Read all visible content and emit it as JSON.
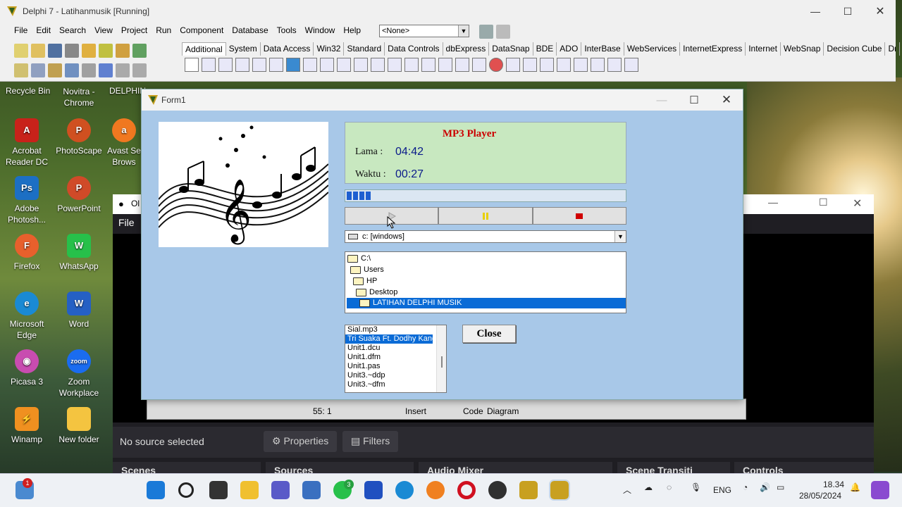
{
  "desktop": {
    "top_labels": [
      "Recycle Bin",
      "Novitra - Chrome",
      "DELPHIN"
    ],
    "icons": [
      {
        "label": "Acrobat Reader DC",
        "icon": "acrobat-icon",
        "color": "#c8221a"
      },
      {
        "label": "PhotoScape",
        "icon": "photoscape-icon",
        "color": "#d05020"
      },
      {
        "label": "Avast Se Brows",
        "icon": "avast-icon",
        "color": "#f07820"
      },
      {
        "label": "Adobe Photosh...",
        "icon": "photoshop-icon",
        "color": "#1c6fc4"
      },
      {
        "label": "PowerPoint",
        "icon": "powerpoint-icon",
        "color": "#d04a28"
      },
      {
        "label": "Firefox",
        "icon": "firefox-icon",
        "color": "#e8602c"
      },
      {
        "label": "WhatsApp",
        "icon": "whatsapp-icon",
        "color": "#27c04a"
      },
      {
        "label": "Microsoft Edge",
        "icon": "edge-icon",
        "color": "#1a8ad4"
      },
      {
        "label": "Word",
        "icon": "word-icon",
        "color": "#2560c4"
      },
      {
        "label": "Picasa 3",
        "icon": "picasa-icon",
        "color": "#c84cb0"
      },
      {
        "label": "Zoom Workplace",
        "icon": "zoom-icon",
        "color": "#1a6cf0"
      },
      {
        "label": "Winamp",
        "icon": "winamp-icon",
        "color": "#f09020"
      },
      {
        "label": "New folder",
        "icon": "folder-icon",
        "color": "#f4c440"
      }
    ]
  },
  "ide": {
    "title": "Delphi 7 - Latihanmusik [Running]",
    "menu": [
      "File",
      "Edit",
      "Search",
      "View",
      "Project",
      "Run",
      "Component",
      "Database",
      "Tools",
      "Window",
      "Help"
    ],
    "combo_value": "<None>",
    "palette_tabs": [
      "Additional",
      "System",
      "Data Access",
      "Win32",
      "Standard",
      "Data Controls",
      "dbExpress",
      "DataSnap",
      "BDE",
      "ADO",
      "InterBase",
      "WebServices",
      "InternetExpress",
      "Internet",
      "WebSnap",
      "Decision Cube",
      "Dι"
    ]
  },
  "obs": {
    "menu_file": "File",
    "title_fragment": "Ol",
    "no_source": "No source selected",
    "properties": "Properties",
    "filters": "Filters",
    "docks": [
      "Scenes",
      "Sources",
      "Audio Mixer",
      "Scene Transiti",
      "Controls"
    ]
  },
  "form1": {
    "title": "Form1",
    "player_title": "MP3 Player",
    "lama_label": "Lama :",
    "lama_value": "04:42",
    "waktu_label": "Waktu :",
    "waktu_value": "00:27",
    "progress_fraction": 0.096,
    "drive": "c: [windows]",
    "dirs": [
      "C:\\",
      "Users",
      "HP",
      "Desktop",
      "LATIHAN DELPHI MUSIK"
    ],
    "files": [
      "Sial.mp3",
      "Tri Suaka Ft. Dodhy Kand",
      "Unit1.dcu",
      "Unit1.dfm",
      "Unit1.pas",
      "Unit3.~ddp",
      "Unit3.~dfm"
    ],
    "selected_file_index": 1,
    "close_label": "Close",
    "colors": {
      "form_bg": "#a8c8e8",
      "panel_bg": "#c8e8c0",
      "title_red": "#cc0000",
      "time_blue": "#0a1a8a",
      "selection": "#0a6bd6"
    }
  },
  "editor_status": {
    "position": "55:  1",
    "mode": "Insert",
    "tab_code": "Code",
    "tab_diagram": "Diagram"
  },
  "taskbar": {
    "lang": "ENG",
    "time": "18.34",
    "date": "28/05/2024",
    "badge_count": "1",
    "teams_badge": "3"
  }
}
